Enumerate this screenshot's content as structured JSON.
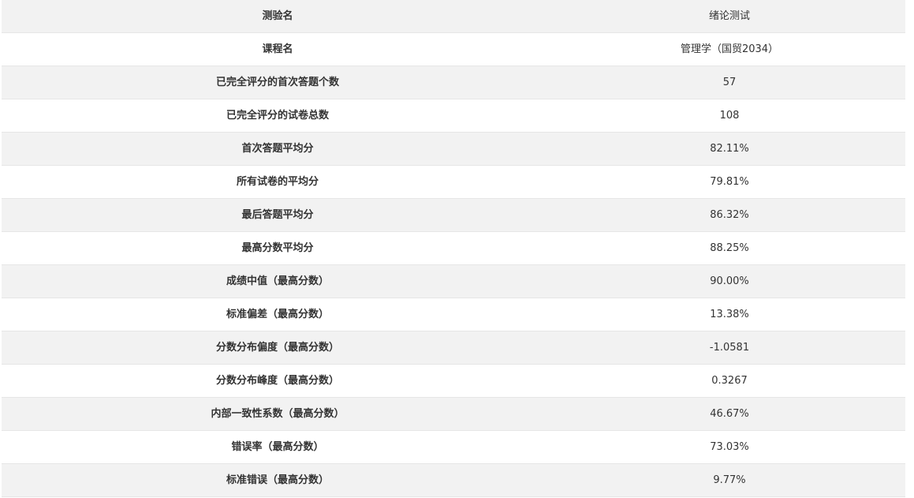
{
  "stats": {
    "rows": [
      {
        "label": "测验名",
        "value": "绪论测试"
      },
      {
        "label": "课程名",
        "value": "管理学（国贸2034）"
      },
      {
        "label": "已完全评分的首次答题个数",
        "value": "57"
      },
      {
        "label": "已完全评分的试卷总数",
        "value": "108"
      },
      {
        "label": "首次答题平均分",
        "value": "82.11%"
      },
      {
        "label": "所有试卷的平均分",
        "value": "79.81%"
      },
      {
        "label": "最后答题平均分",
        "value": "86.32%"
      },
      {
        "label": "最高分数平均分",
        "value": "88.25%"
      },
      {
        "label": "成绩中值（最高分数）",
        "value": "90.00%"
      },
      {
        "label": "标准偏差（最高分数）",
        "value": "13.38%"
      },
      {
        "label": "分数分布偏度（最高分数）",
        "value": "-1.0581"
      },
      {
        "label": "分数分布峰度（最高分数）",
        "value": "0.3267"
      },
      {
        "label": "内部一致性系数（最高分数）",
        "value": "46.67%"
      },
      {
        "label": "错误率（最高分数）",
        "value": "73.03%"
      },
      {
        "label": "标准错误（最高分数）",
        "value": "9.77%"
      }
    ]
  }
}
